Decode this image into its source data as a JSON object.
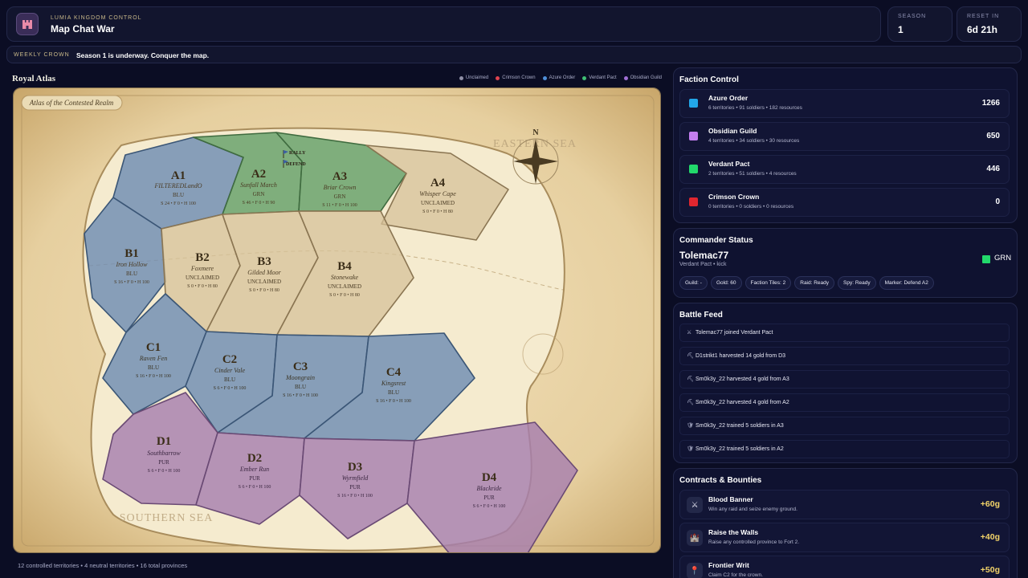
{
  "header": {
    "subtitle": "LUMIA KINGDOM CONTROL",
    "title": "Map Chat War",
    "season_label": "SEASON",
    "season_value": "1",
    "reset_label": "RESET IN",
    "reset_value": "6d 21h"
  },
  "banner": {
    "tag": "WEEKLY CROWN",
    "message": "Season 1 is underway. Conquer the map."
  },
  "map": {
    "title": "Royal Atlas",
    "cartouche": "Atlas of the Contested Realm",
    "compass": "N",
    "sea_east": "EASTERN SEA",
    "sea_south": "SOUTHERN SEA",
    "rally": "RALLY",
    "defend": "DEFEND",
    "legend": [
      {
        "label": "Unclaimed",
        "color": "#8f8fa6"
      },
      {
        "label": "Crimson Crown",
        "color": "#e0434f"
      },
      {
        "label": "Azure Order",
        "color": "#4f8fd9"
      },
      {
        "label": "Verdant Pact",
        "color": "#3fbf74"
      },
      {
        "label": "Obsidian Guild",
        "color": "#a06fd6"
      }
    ],
    "territories": {
      "A1": {
        "code": "A1",
        "name": "FILTEREDLandO",
        "owner": "BLU",
        "stats": "S 24 • F 0 • H 100"
      },
      "A2": {
        "code": "A2",
        "name": "Sunfall March",
        "owner": "GRN",
        "stats": "S 46 • F 0 • H 90"
      },
      "A3": {
        "code": "A3",
        "name": "Briar Crown",
        "owner": "GRN",
        "stats": "S 11 • F 0 • H 100"
      },
      "A4": {
        "code": "A4",
        "name": "Whisper Cape",
        "owner": "UNCLAIMED",
        "stats": "S 0 • F 0 • H 80"
      },
      "B1": {
        "code": "B1",
        "name": "Iron Hollow",
        "owner": "BLU",
        "stats": "S 16 • F 0 • H 100"
      },
      "B2": {
        "code": "B2",
        "name": "Foxmere",
        "owner": "UNCLAIMED",
        "stats": "S 0 • F 0 • H 80"
      },
      "B3": {
        "code": "B3",
        "name": "Gilded Moor",
        "owner": "UNCLAIMED",
        "stats": "S 0 • F 0 • H 80"
      },
      "B4": {
        "code": "B4",
        "name": "Stonewake",
        "owner": "UNCLAIMED",
        "stats": "S 0 • F 0 • H 80"
      },
      "C1": {
        "code": "C1",
        "name": "Raven Fen",
        "owner": "BLU",
        "stats": "S 16 • F 0 • H 100"
      },
      "C2": {
        "code": "C2",
        "name": "Cinder Vale",
        "owner": "BLU",
        "stats": "S 6 • F 0 • H 100"
      },
      "C3": {
        "code": "C3",
        "name": "Moongrain",
        "owner": "BLU",
        "stats": "S 16 • F 0 • H 100"
      },
      "C4": {
        "code": "C4",
        "name": "Kingsrest",
        "owner": "BLU",
        "stats": "S 16 • F 0 • H 100"
      },
      "D1": {
        "code": "D1",
        "name": "Southbarrow",
        "owner": "PUR",
        "stats": "S 6 • F 0 • H 100"
      },
      "D2": {
        "code": "D2",
        "name": "Ember Run",
        "owner": "PUR",
        "stats": "S 6 • F 0 • H 100"
      },
      "D3": {
        "code": "D3",
        "name": "Wyrmfield",
        "owner": "PUR",
        "stats": "S 16 • F 0 • H 100"
      },
      "D4": {
        "code": "D4",
        "name": "Blackride",
        "owner": "PUR",
        "stats": "S 6 • F 0 • H 100"
      }
    },
    "footer": "12 controlled territories • 4 neutral territories • 16 total provinces"
  },
  "faction_panel": {
    "title": "Faction Control",
    "factions": [
      {
        "name": "Azure Order",
        "desc": "6 territories • 91 soldiers • 182 resources",
        "score": "1266",
        "color": "#22a6e8"
      },
      {
        "name": "Obsidian Guild",
        "desc": "4 territories • 34 soldiers • 30 resources",
        "score": "650",
        "color": "#c47ef0"
      },
      {
        "name": "Verdant Pact",
        "desc": "2 territories • 51 soldiers • 4 resources",
        "score": "446",
        "color": "#22d96b"
      },
      {
        "name": "Crimson Crown",
        "desc": "0 territories • 0 soldiers • 0 resources",
        "score": "0",
        "color": "#e0262f"
      }
    ]
  },
  "commander": {
    "title": "Commander Status",
    "name": "Tolemac77",
    "sub": "Verdant Pact • kick",
    "tag": "GRN",
    "chips": [
      "Guild: -",
      "Gold: 60",
      "Faction Tiles: 2",
      "Raid: Ready",
      "Spy: Ready",
      "Marker: Defend A2"
    ]
  },
  "feed": {
    "title": "Battle Feed",
    "items": [
      {
        "icon": "⚔",
        "text": "Tolemac77 joined Verdant Pact"
      },
      {
        "icon": "⛏",
        "text": "D1strikt1 harvested 14 gold from D3"
      },
      {
        "icon": "⛏",
        "text": "Sm0k3y_22 harvested 4 gold from A3"
      },
      {
        "icon": "⛏",
        "text": "Sm0k3y_22 harvested 4 gold from A2"
      },
      {
        "icon": "🛡",
        "text": "Sm0k3y_22 trained 5 soldiers in A3"
      },
      {
        "icon": "🛡",
        "text": "Sm0k3y_22 trained 5 soldiers in A2"
      }
    ]
  },
  "contracts": {
    "title": "Contracts & Bounties",
    "items": [
      {
        "name": "Blood Banner",
        "desc": "Win any raid and seize enemy ground.",
        "reward": "+60g",
        "icon": "⚔"
      },
      {
        "name": "Raise the Walls",
        "desc": "Raise any controlled province to Fort 2.",
        "reward": "+40g",
        "icon": "🏰"
      },
      {
        "name": "Frontier Writ",
        "desc": "Claim C2 for the crown.",
        "reward": "+50g",
        "icon": "📍"
      }
    ]
  }
}
